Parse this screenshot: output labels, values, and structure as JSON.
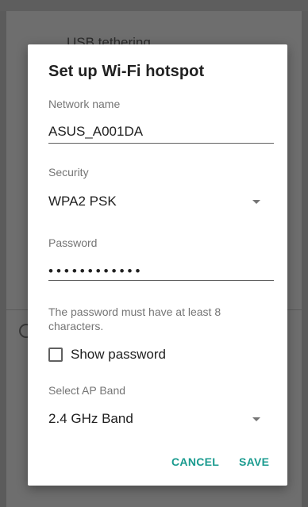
{
  "background": {
    "list_item_label": "USB tethering"
  },
  "dialog": {
    "title": "Set up Wi-Fi hotspot",
    "network_name": {
      "label": "Network name",
      "value": "ASUS_A001DA"
    },
    "security": {
      "label": "Security",
      "selected": "WPA2 PSK"
    },
    "password": {
      "label": "Password",
      "masked_value": "••••••••••••"
    },
    "password_hint": "The password must have at least 8 characters.",
    "show_password": {
      "label": "Show password",
      "checked": false
    },
    "ap_band": {
      "label": "Select AP Band",
      "selected": "2.4 GHz Band"
    },
    "buttons": {
      "cancel": "CANCEL",
      "save": "SAVE"
    }
  },
  "colors": {
    "accent": "#1a9b8f",
    "scrim": "#5b5b5b",
    "dialog_background": "#ffffff"
  }
}
